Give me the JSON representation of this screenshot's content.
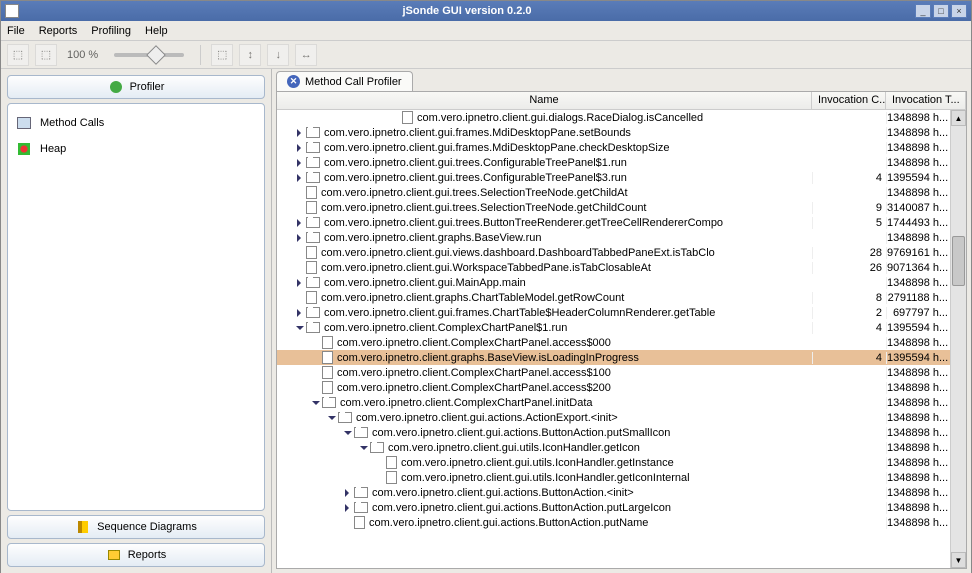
{
  "window": {
    "title": "jSonde GUI version 0.2.0"
  },
  "menu": {
    "file": "File",
    "reports": "Reports",
    "profiling": "Profiling",
    "help": "Help"
  },
  "toolbar": {
    "zoom": "100 %"
  },
  "sidebar": {
    "profiler": "Profiler",
    "method_calls": "Method Calls",
    "heap": "Heap",
    "sequence": "Sequence Diagrams",
    "reports": "Reports"
  },
  "tab": {
    "label": "Method Call Profiler"
  },
  "columns": {
    "name": "Name",
    "count": "Invocation C...",
    "time": "Invocation T..."
  },
  "rows": [
    {
      "indent": 7,
      "twisty": "none",
      "icon": "file",
      "name": "com.vero.ipnetro.client.gui.dialogs.RaceDialog.isCancelled",
      "c": "",
      "t": "1348898 h..."
    },
    {
      "indent": 1,
      "twisty": "col",
      "icon": "folder",
      "name": "com.vero.ipnetro.client.gui.frames.MdiDesktopPane.setBounds",
      "c": "",
      "t": "1348898 h..."
    },
    {
      "indent": 1,
      "twisty": "col",
      "icon": "folder",
      "name": "com.vero.ipnetro.client.gui.frames.MdiDesktopPane.checkDesktopSize",
      "c": "",
      "t": "1348898 h..."
    },
    {
      "indent": 1,
      "twisty": "col",
      "icon": "folder",
      "name": "com.vero.ipnetro.client.gui.trees.ConfigurableTreePanel$1.run",
      "c": "",
      "t": "1348898 h..."
    },
    {
      "indent": 1,
      "twisty": "col",
      "icon": "folder",
      "name": "com.vero.ipnetro.client.gui.trees.ConfigurableTreePanel$3.run",
      "c": "4",
      "t": "1395594 h..."
    },
    {
      "indent": 1,
      "twisty": "none",
      "icon": "file",
      "name": "com.vero.ipnetro.client.gui.trees.SelectionTreeNode.getChildAt",
      "c": "",
      "t": "1348898 h..."
    },
    {
      "indent": 1,
      "twisty": "none",
      "icon": "file",
      "name": "com.vero.ipnetro.client.gui.trees.SelectionTreeNode.getChildCount",
      "c": "9",
      "t": "3140087 h..."
    },
    {
      "indent": 1,
      "twisty": "col",
      "icon": "folder",
      "name": "com.vero.ipnetro.client.gui.trees.ButtonTreeRenderer.getTreeCellRendererCompo",
      "c": "5",
      "t": "1744493 h..."
    },
    {
      "indent": 1,
      "twisty": "col",
      "icon": "folder",
      "name": "com.vero.ipnetro.client.graphs.BaseView.run",
      "c": "",
      "t": "1348898 h..."
    },
    {
      "indent": 1,
      "twisty": "none",
      "icon": "file",
      "name": "com.vero.ipnetro.client.gui.views.dashboard.DashboardTabbedPaneExt.isTabClo",
      "c": "28",
      "t": "9769161 h..."
    },
    {
      "indent": 1,
      "twisty": "none",
      "icon": "file",
      "name": "com.vero.ipnetro.client.gui.WorkspaceTabbedPane.isTabClosableAt",
      "c": "26",
      "t": "9071364 h..."
    },
    {
      "indent": 1,
      "twisty": "col",
      "icon": "folder",
      "name": "com.vero.ipnetro.client.gui.MainApp.main",
      "c": "",
      "t": "1348898 h..."
    },
    {
      "indent": 1,
      "twisty": "none",
      "icon": "file",
      "name": "com.vero.ipnetro.client.graphs.ChartTableModel.getRowCount",
      "c": "8",
      "t": "2791188 h..."
    },
    {
      "indent": 1,
      "twisty": "col",
      "icon": "folder",
      "name": "com.vero.ipnetro.client.gui.frames.ChartTable$HeaderColumnRenderer.getTable",
      "c": "2",
      "t": "697797 h..."
    },
    {
      "indent": 1,
      "twisty": "exp",
      "icon": "folder",
      "name": "com.vero.ipnetro.client.ComplexChartPanel$1.run",
      "c": "4",
      "t": "1395594 h..."
    },
    {
      "indent": 2,
      "twisty": "none",
      "icon": "file",
      "name": "com.vero.ipnetro.client.ComplexChartPanel.access$000",
      "c": "",
      "t": "1348898 h..."
    },
    {
      "indent": 2,
      "twisty": "none",
      "icon": "file",
      "name": "com.vero.ipnetro.client.graphs.BaseView.isLoadingInProgress",
      "c": "4",
      "t": "1395594 h...",
      "sel": true
    },
    {
      "indent": 2,
      "twisty": "none",
      "icon": "file",
      "name": "com.vero.ipnetro.client.ComplexChartPanel.access$100",
      "c": "",
      "t": "1348898 h..."
    },
    {
      "indent": 2,
      "twisty": "none",
      "icon": "file",
      "name": "com.vero.ipnetro.client.ComplexChartPanel.access$200",
      "c": "",
      "t": "1348898 h..."
    },
    {
      "indent": 2,
      "twisty": "exp",
      "icon": "folder",
      "name": "com.vero.ipnetro.client.ComplexChartPanel.initData",
      "c": "",
      "t": "1348898 h..."
    },
    {
      "indent": 3,
      "twisty": "exp",
      "icon": "folder",
      "name": "com.vero.ipnetro.client.gui.actions.ActionExport.<init>",
      "c": "",
      "t": "1348898 h..."
    },
    {
      "indent": 4,
      "twisty": "exp",
      "icon": "folder",
      "name": "com.vero.ipnetro.client.gui.actions.ButtonAction.putSmallIcon",
      "c": "",
      "t": "1348898 h..."
    },
    {
      "indent": 5,
      "twisty": "exp",
      "icon": "folder",
      "name": "com.vero.ipnetro.client.gui.utils.IconHandler.getIcon",
      "c": "",
      "t": "1348898 h..."
    },
    {
      "indent": 6,
      "twisty": "none",
      "icon": "file",
      "name": "com.vero.ipnetro.client.gui.utils.IconHandler.getInstance",
      "c": "",
      "t": "1348898 h..."
    },
    {
      "indent": 6,
      "twisty": "none",
      "icon": "file",
      "name": "com.vero.ipnetro.client.gui.utils.IconHandler.getIconInternal",
      "c": "",
      "t": "1348898 h..."
    },
    {
      "indent": 4,
      "twisty": "col",
      "icon": "folder",
      "name": "com.vero.ipnetro.client.gui.actions.ButtonAction.<init>",
      "c": "",
      "t": "1348898 h..."
    },
    {
      "indent": 4,
      "twisty": "col",
      "icon": "folder",
      "name": "com.vero.ipnetro.client.gui.actions.ButtonAction.putLargeIcon",
      "c": "",
      "t": "1348898 h..."
    },
    {
      "indent": 4,
      "twisty": "none",
      "icon": "file",
      "name": "com.vero.ipnetro.client.gui.actions.ButtonAction.putName",
      "c": "",
      "t": "1348898 h..."
    }
  ]
}
